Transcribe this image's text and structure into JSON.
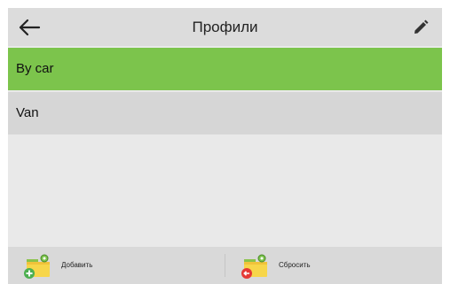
{
  "header": {
    "title": "Профили",
    "back_icon": "arrow-left-icon",
    "edit_icon": "pencil-icon"
  },
  "profiles": [
    {
      "label": "By car",
      "selected": true
    },
    {
      "label": "Van",
      "selected": false
    }
  ],
  "footer": {
    "add_label": "Добавить",
    "reset_label": "Сбросить"
  },
  "colors": {
    "selected": "#7cc44c",
    "item": "#d6d6d6",
    "header": "#dcdcdc",
    "background": "#e9e9e9"
  }
}
